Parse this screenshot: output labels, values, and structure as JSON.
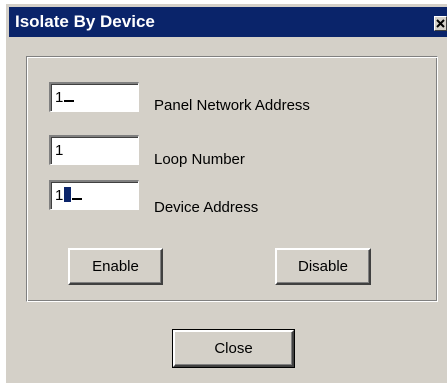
{
  "window": {
    "title": "Isolate By Device",
    "close_glyph": "close-icon"
  },
  "fields": {
    "panel_network_address": {
      "value": "1",
      "label": "Panel Network Address"
    },
    "loop_number": {
      "value": "1",
      "label": "Loop Number"
    },
    "device_address": {
      "value": "1",
      "label": "Device Address"
    }
  },
  "buttons": {
    "enable": "Enable",
    "disable": "Disable",
    "close": "Close"
  },
  "colors": {
    "titlebar": "#0a246a",
    "face": "#d4d0c8"
  }
}
